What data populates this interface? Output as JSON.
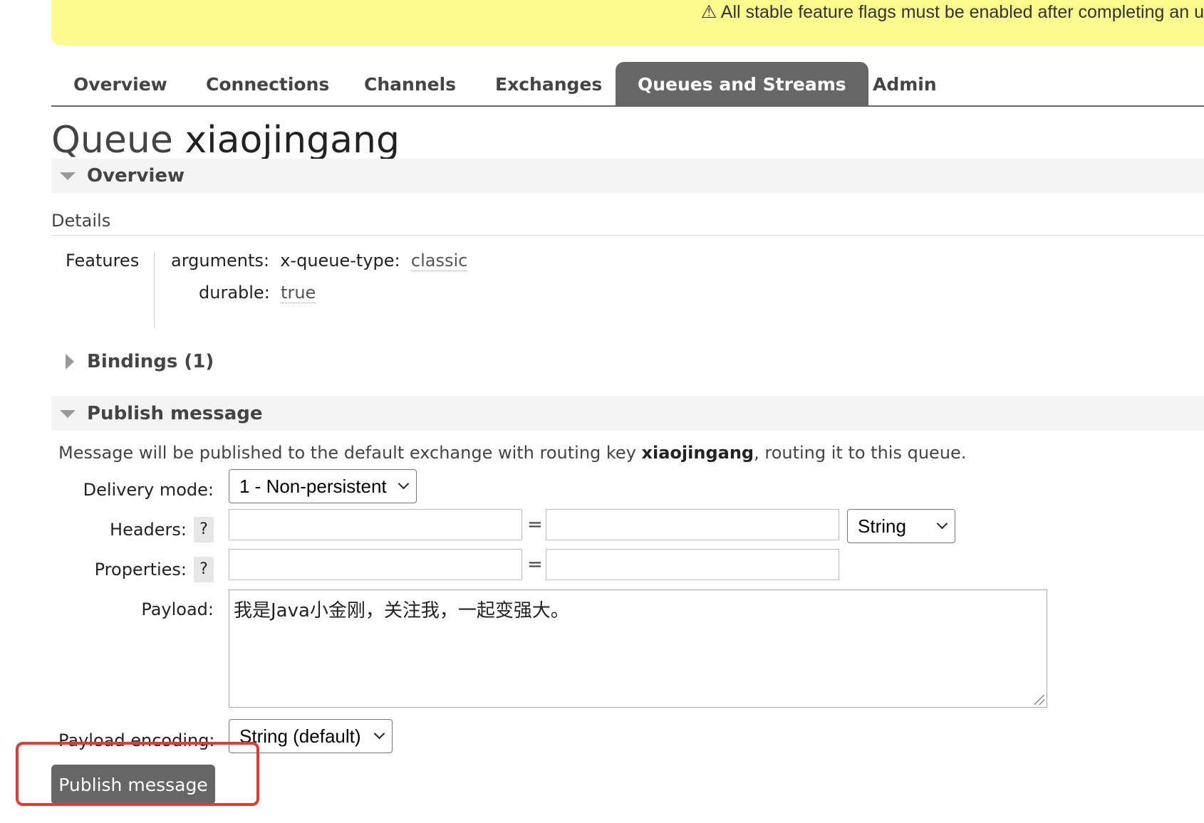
{
  "banner": {
    "text": "⚠ All stable feature flags must be enabled after completing an u"
  },
  "nav": {
    "tabs": [
      {
        "label": "Overview"
      },
      {
        "label": "Connections"
      },
      {
        "label": "Channels"
      },
      {
        "label": "Exchanges"
      },
      {
        "label": "Queues and Streams",
        "active": true
      },
      {
        "label": "Admin"
      }
    ]
  },
  "page": {
    "title_prefix": "Queue",
    "queue_name": "xiaojingang"
  },
  "overview": {
    "heading": "Overview",
    "details_label": "Details",
    "features_label": "Features",
    "arguments_key": "arguments:",
    "queue_type_key": "x-queue-type:",
    "queue_type_value": "classic",
    "durable_key": "durable:",
    "durable_value": "true"
  },
  "bindings": {
    "heading": "Bindings (1)"
  },
  "publish": {
    "heading": "Publish message",
    "desc_prefix": "Message will be published to the default exchange with routing key ",
    "routing_key": "xiaojingang",
    "desc_suffix": ", routing it to this queue.",
    "delivery_mode_label": "Delivery mode:",
    "delivery_mode_value": "1 - Non-persistent",
    "headers_label": "Headers:",
    "properties_label": "Properties:",
    "help_mark": "?",
    "equals": "=",
    "header_type_value": "String",
    "header_key_value": "",
    "header_val_value": "",
    "property_key_value": "",
    "property_val_value": "",
    "payload_label": "Payload:",
    "payload_value": "我是Java小金刚，关注我，一起变强大。",
    "payload_encoding_label": "Payload encoding:",
    "payload_encoding_value": "String (default)",
    "button_label": "Publish message"
  },
  "colors": {
    "banner": "#fbfb8e",
    "tab_active": "#666666",
    "highlight": "#e53935"
  }
}
